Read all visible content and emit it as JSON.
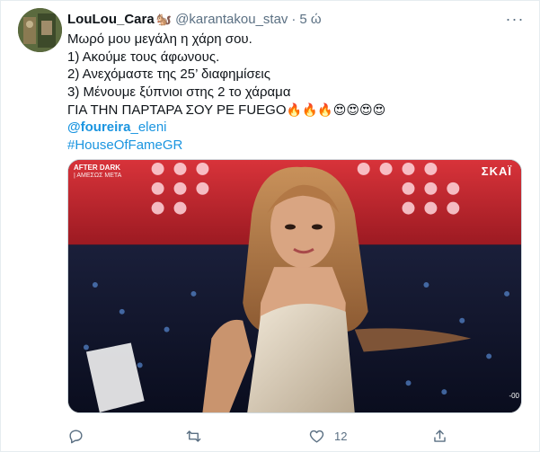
{
  "author": {
    "display_name": "LouLou_Cara",
    "name_emoji": "🐿️",
    "handle": "@karantakou_stav",
    "separator": "·",
    "time": "5 ώ"
  },
  "tweet": {
    "lines": [
      "Μωρό μου μεγάλη η χάρη σου.",
      "1) Ακούμε τους άφωνους.",
      "2) Ανεχόμαστε της 25’ διαφημίσεις",
      "3) Μένουμε ξύπνιοι στης 2 το χάραμα"
    ],
    "shout": "ΓΙΑ ΤΗΝ ΠΑΡΤΑΡΑ ΣΟΥ ΡΕ FUEGO",
    "shout_emojis": "🔥🔥🔥😍😍😍😍",
    "mention_bold": "@foureira",
    "mention_rest": "_eleni",
    "hashtag": "#HouseOfFameGR"
  },
  "media": {
    "ticker_top": "AFTER DARK",
    "ticker_sub": "| ΑΜΕΣΩΣ ΜΕΤΑ",
    "channel_logo": "ΣΚΑΪ",
    "corner_text": "-00"
  },
  "actions": {
    "reply_icon": "reply-icon",
    "retweet_icon": "retweet-icon",
    "like_icon": "heart-icon",
    "like_count": "12",
    "share_icon": "share-icon"
  },
  "colors": {
    "link": "#1b95e0",
    "secondary_text": "#5b7083",
    "border": "#e6ecf0"
  }
}
